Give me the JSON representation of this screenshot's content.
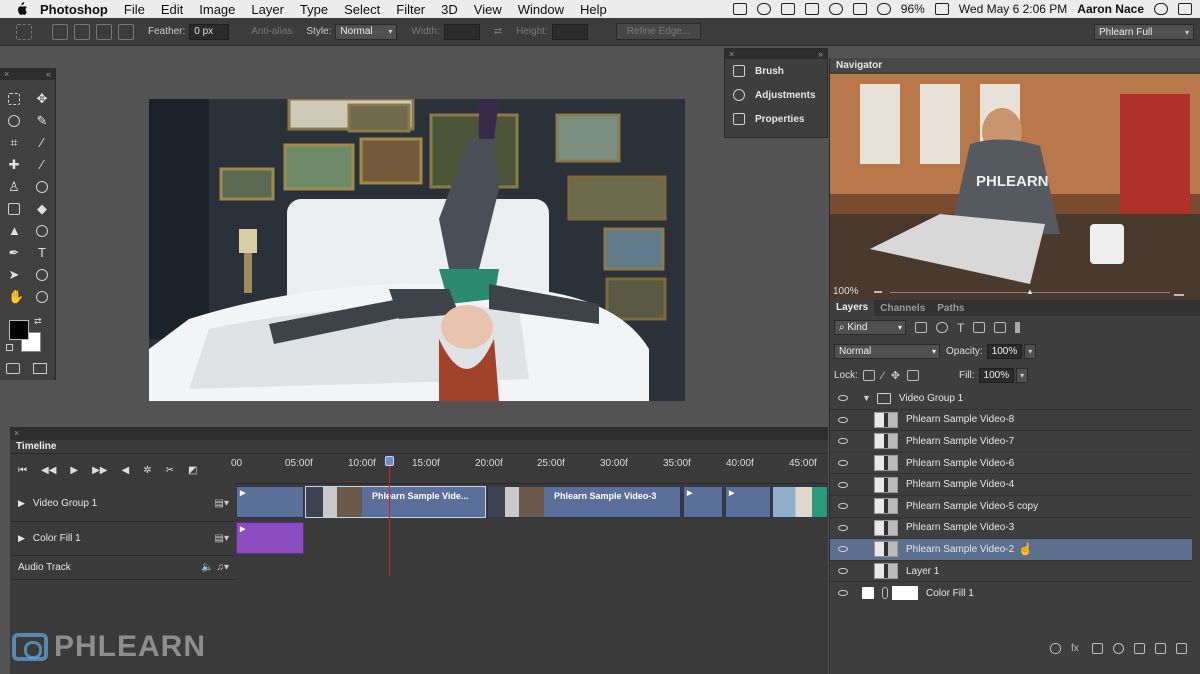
{
  "menubar": {
    "app_name": "Photoshop",
    "items": [
      "File",
      "Edit",
      "Image",
      "Layer",
      "Type",
      "Select",
      "Filter",
      "3D",
      "View",
      "Window",
      "Help"
    ],
    "battery": "96%",
    "datetime": "Wed May 6  2:06 PM",
    "user": "Aaron Nace"
  },
  "options_bar": {
    "feather_label": "Feather:",
    "feather_value": "0 px",
    "antialias_label": "Anti-alias",
    "style_label": "Style:",
    "style_value": "Normal",
    "width_label": "Width:",
    "height_label": "Height:",
    "refine_edge_label": "Refine Edge...",
    "workspace_value": "Phlearn Full"
  },
  "side_panel": {
    "items": [
      "Brush",
      "Adjustments",
      "Properties"
    ]
  },
  "navigator": {
    "title": "Navigator",
    "zoom": "100%"
  },
  "layers_panel": {
    "tabs": [
      "Layers",
      "Channels",
      "Paths"
    ],
    "filter_kind": "Kind",
    "blend_mode": "Normal",
    "opacity_label": "Opacity:",
    "opacity_value": "100%",
    "lock_label": "Lock:",
    "fill_label": "Fill:",
    "fill_value": "100%",
    "layers": [
      {
        "name": "Video Group 1",
        "type": "group"
      },
      {
        "name": "Phlearn Sample Video-8",
        "type": "video"
      },
      {
        "name": "Phlearn Sample Video-7",
        "type": "video"
      },
      {
        "name": "Phlearn Sample Video-6",
        "type": "video"
      },
      {
        "name": "Phlearn Sample Video-4",
        "type": "video"
      },
      {
        "name": "Phlearn Sample Video-5 copy",
        "type": "video"
      },
      {
        "name": "Phlearn Sample Video-3",
        "type": "video"
      },
      {
        "name": "Phlearn Sample Video-2",
        "type": "video",
        "selected": true
      },
      {
        "name": "Layer 1",
        "type": "video"
      },
      {
        "name": "Color Fill 1",
        "type": "fill"
      }
    ]
  },
  "timeline": {
    "title": "Timeline",
    "ruler": [
      "00",
      "05:00f",
      "10:00f",
      "15:00f",
      "20:00f",
      "25:00f",
      "30:00f",
      "35:00f",
      "40:00f",
      "45:00f"
    ],
    "tracks": [
      "Video Group 1",
      "Color Fill 1",
      "Audio Track"
    ],
    "clips": [
      {
        "label": ""
      },
      {
        "label": "Phlearn Sample Vide..."
      },
      {
        "label": "Phlearn Sample Video-3"
      },
      {
        "label": ""
      },
      {
        "label": ""
      },
      {
        "label": ""
      }
    ]
  },
  "watermark": "PHLEARN",
  "canvas_overlay": "PHLEARN",
  "colors": {
    "accent_selection": "#5d6f8e",
    "clip_video": "#5a6f99",
    "clip_fill": "#8a4cbf",
    "playhead": "#d02020"
  }
}
